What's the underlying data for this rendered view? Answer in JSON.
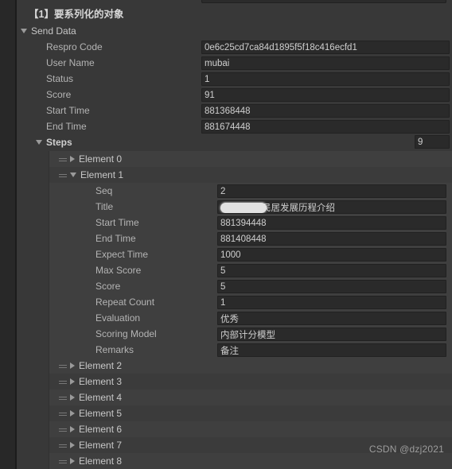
{
  "window": {
    "title": "【1】要系列化的对象",
    "watermark": "CSDN @dzj2021",
    "colors": {
      "panel_bg": "#383838",
      "list_bg": "#3f3f3f",
      "field_bg": "#2a2a2a",
      "field_border": "#212121",
      "label_text": "#b4b4b4",
      "value_text": "#cfcfcf",
      "gutter": "#282828"
    }
  },
  "root": {
    "foldout_label": "Send Data",
    "foldout_icon": "triangle-down-icon",
    "expanded": true
  },
  "send_data_fields": [
    {
      "label": "Respro Code",
      "value": "0e6c25cd7ca84d1895f5f18c416ecfd1"
    },
    {
      "label": "User Name",
      "value": "mubai"
    },
    {
      "label": "Status",
      "value": "1"
    },
    {
      "label": "Score",
      "value": "91"
    },
    {
      "label": "Start Time",
      "value": "881368448"
    },
    {
      "label": "End Time",
      "value": "881674448"
    }
  ],
  "steps": {
    "label": "Steps",
    "foldout_icon": "triangle-down-icon",
    "expanded": true,
    "size_value": "9",
    "elements": [
      {
        "label": "Element 0",
        "expanded": false,
        "icon": "triangle-right-icon",
        "handle": "drag-handle-icon"
      },
      {
        "label": "Element 1",
        "expanded": true,
        "icon": "triangle-down-icon",
        "handle": "drag-handle-icon"
      },
      {
        "label": "Element 2",
        "expanded": false,
        "icon": "triangle-right-icon",
        "handle": "drag-handle-icon"
      },
      {
        "label": "Element 3",
        "expanded": false,
        "icon": "triangle-right-icon",
        "handle": "drag-handle-icon"
      },
      {
        "label": "Element 4",
        "expanded": false,
        "icon": "triangle-right-icon",
        "handle": "drag-handle-icon"
      },
      {
        "label": "Element 5",
        "expanded": false,
        "icon": "triangle-right-icon",
        "handle": "drag-handle-icon"
      },
      {
        "label": "Element 6",
        "expanded": false,
        "icon": "triangle-right-icon",
        "handle": "drag-handle-icon"
      },
      {
        "label": "Element 7",
        "expanded": false,
        "icon": "triangle-right-icon",
        "handle": "drag-handle-icon"
      },
      {
        "label": "Element 8",
        "expanded": false,
        "icon": "triangle-right-icon",
        "handle": "drag-handle-icon"
      }
    ]
  },
  "element_1_fields": [
    {
      "label": "Seq",
      "value": "2"
    },
    {
      "label": "Title",
      "value": "民居发展历程介绍",
      "redacted": true
    },
    {
      "label": "Start Time",
      "value": "881394448"
    },
    {
      "label": "End Time",
      "value": "881408448"
    },
    {
      "label": "Expect Time",
      "value": "1000"
    },
    {
      "label": "Max Score",
      "value": "5"
    },
    {
      "label": "Score",
      "value": "5"
    },
    {
      "label": "Repeat Count",
      "value": "1"
    },
    {
      "label": "Evaluation",
      "value": "优秀"
    },
    {
      "label": "Scoring Model",
      "value": "内部计分模型"
    },
    {
      "label": "Remarks",
      "value": "备注"
    }
  ]
}
